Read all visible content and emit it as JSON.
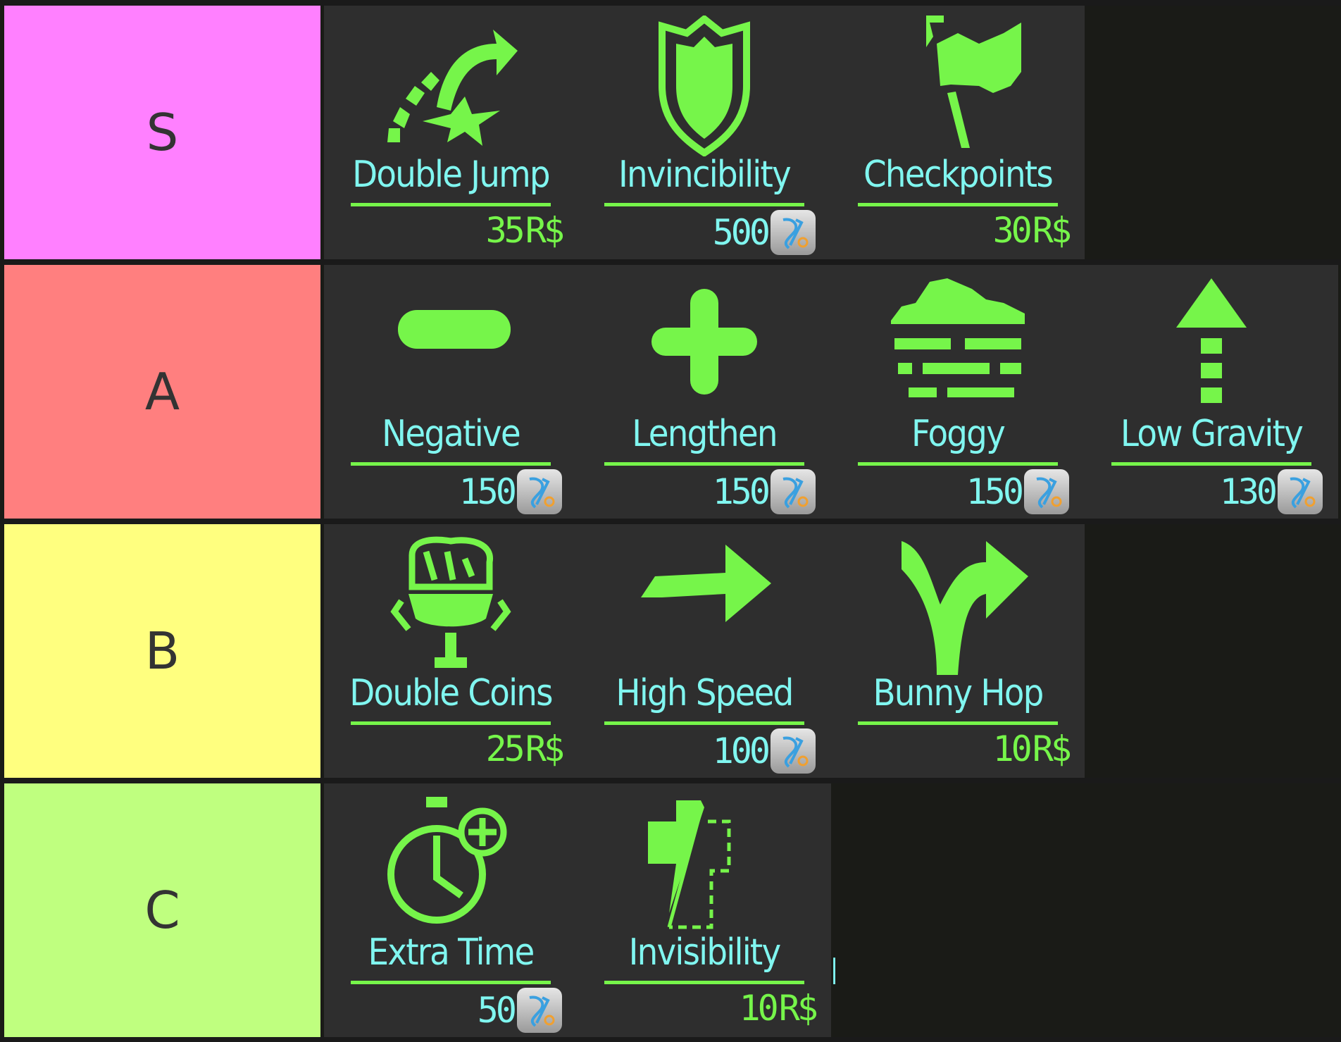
{
  "colors": {
    "accent_green": "#76f54a",
    "text_cyan": "#80f6f0",
    "tile_bg": "#2e2e2e",
    "empty_bg": "#1a1b17"
  },
  "tiers": [
    {
      "label": "S",
      "color": "#ff80ff",
      "items": [
        {
          "name": "Double Jump",
          "price": "35",
          "currency": "R$",
          "icon": "double-jump-icon"
        },
        {
          "name": "Invincibility",
          "price": "500",
          "currency": "token",
          "icon": "shield-icon"
        },
        {
          "name": "Checkpoints",
          "price": "30",
          "currency": "R$",
          "icon": "flag-icon"
        }
      ]
    },
    {
      "label": "A",
      "color": "#ff7f7f",
      "items": [
        {
          "name": "Negative",
          "price": "150",
          "currency": "token",
          "icon": "minus-icon"
        },
        {
          "name": "Lengthen",
          "price": "150",
          "currency": "token",
          "icon": "plus-icon"
        },
        {
          "name": "Foggy",
          "price": "150",
          "currency": "token",
          "icon": "fog-icon"
        },
        {
          "name": "Low Gravity",
          "price": "130",
          "currency": "token",
          "icon": "arrow-up-icon"
        }
      ]
    },
    {
      "label": "B",
      "color": "#ffff7f",
      "items": [
        {
          "name": "Double Coins",
          "price": "25",
          "currency": "R$",
          "icon": "coin-trophy-icon"
        },
        {
          "name": "High Speed",
          "price": "100",
          "currency": "token",
          "icon": "arrow-right-icon"
        },
        {
          "name": "Bunny Hop",
          "price": "10",
          "currency": "R$",
          "icon": "fork-arrow-icon"
        }
      ]
    },
    {
      "label": "C",
      "color": "#bfff7f",
      "items": [
        {
          "name": "Extra Time",
          "price": "50",
          "currency": "token",
          "icon": "stopwatch-plus-icon"
        },
        {
          "name": "Invisibility",
          "price": "10",
          "currency": "R$",
          "icon": "invisibility-icon"
        }
      ],
      "fragment": "I"
    }
  ]
}
